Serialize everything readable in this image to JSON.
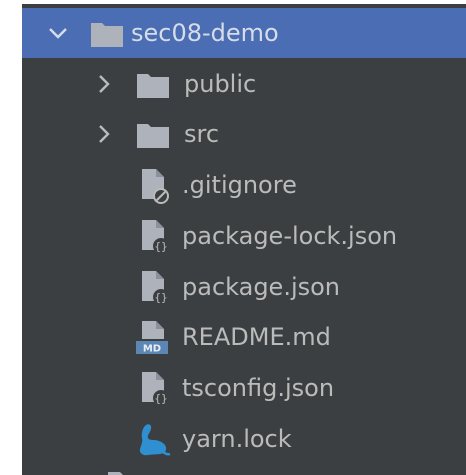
{
  "project_tree": {
    "root": {
      "label": "sec08-demo",
      "expanded": true,
      "icon": "folder-icon"
    },
    "items": [
      {
        "label": "public",
        "type": "folder",
        "expanded": false,
        "icon": "folder-icon"
      },
      {
        "label": "src",
        "type": "folder",
        "expanded": false,
        "icon": "folder-icon"
      },
      {
        "label": ".gitignore",
        "type": "file",
        "icon": "gitignore-file-icon"
      },
      {
        "label": "package-lock.json",
        "type": "file",
        "icon": "json-file-icon"
      },
      {
        "label": "package.json",
        "type": "file",
        "icon": "json-file-icon"
      },
      {
        "label": "README.md",
        "type": "file",
        "icon": "markdown-file-icon"
      },
      {
        "label": "tsconfig.json",
        "type": "file",
        "icon": "json-file-icon"
      },
      {
        "label": "yarn.lock",
        "type": "file",
        "icon": "yarn-icon"
      }
    ],
    "md_badge": "MD"
  },
  "colors": {
    "panel_bg": "#3c3f41",
    "selection_bg": "#4a6db3",
    "text": "#bbbbbb",
    "folder": "#aeb3bb",
    "yarn": "#2f8fd1"
  }
}
